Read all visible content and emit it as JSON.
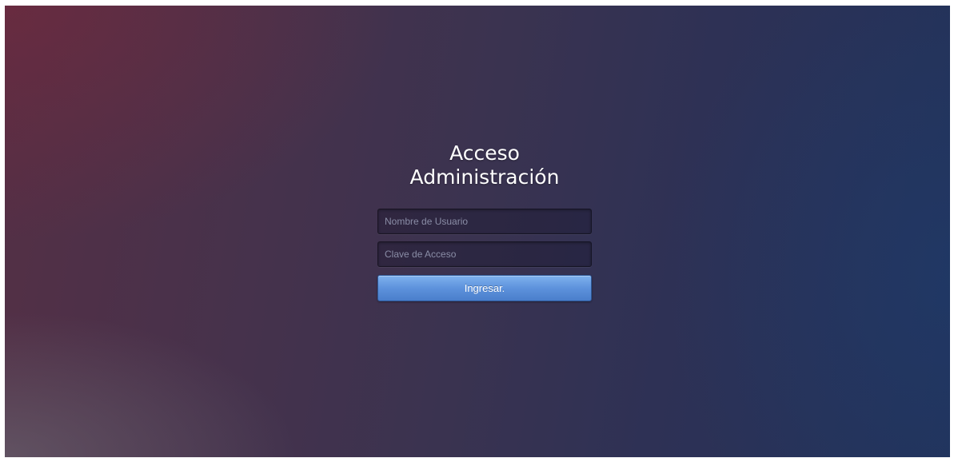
{
  "login": {
    "title_line1": "Acceso",
    "title_line2": "Administración",
    "username": {
      "value": "",
      "placeholder": "Nombre de Usuario"
    },
    "password": {
      "value": "",
      "placeholder": "Clave de Acceso"
    },
    "submit_label": "Ingresar."
  },
  "colors": {
    "button_accent": "#5d92dc",
    "background_left": "#552f45",
    "background_right": "#223259"
  }
}
